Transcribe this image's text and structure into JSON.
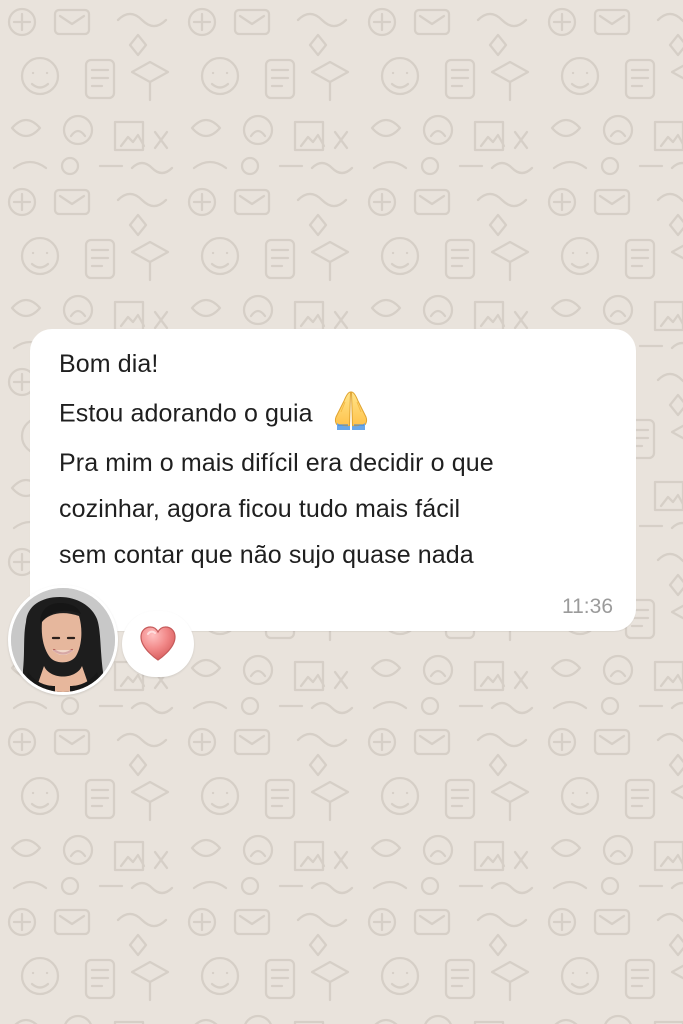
{
  "chat": {
    "message": {
      "lines": [
        "Bom dia!",
        "Estou adorando o guia",
        "Pra mim o mais difícil era decidir o que",
        "cozinhar, agora ficou tudo mais fácil",
        "sem contar que não sujo quase nada"
      ],
      "emoji_after_line_2": "folded-hands-emoji",
      "time": "11:36"
    },
    "reaction": {
      "icon": "heart-icon",
      "color": "#f28a8a"
    },
    "avatar": {
      "icon": "profile-photo-avatar"
    }
  }
}
